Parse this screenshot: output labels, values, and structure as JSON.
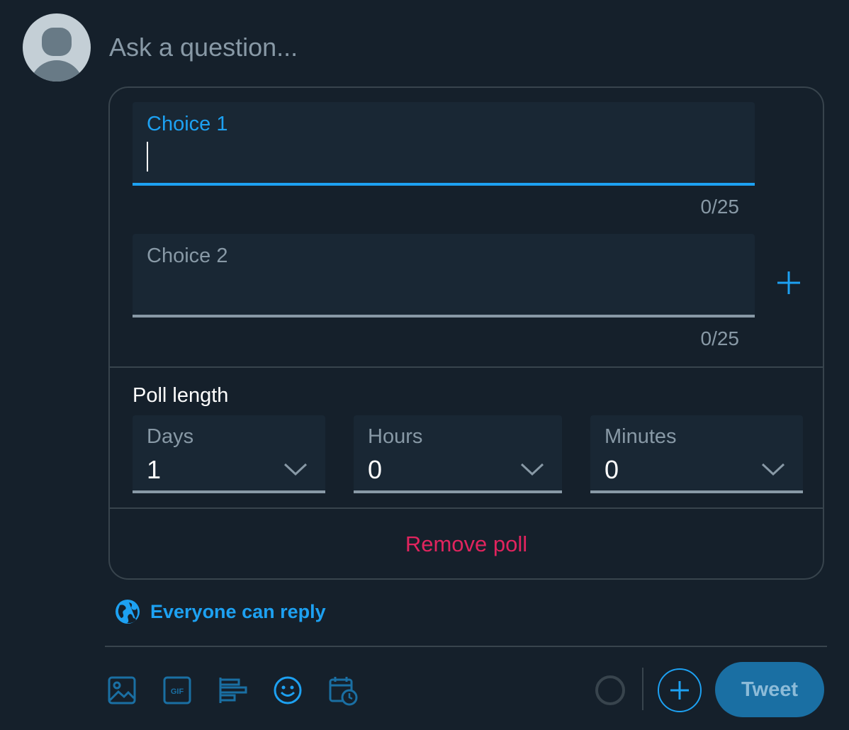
{
  "composer": {
    "placeholder": "Ask a question..."
  },
  "poll": {
    "choices": [
      {
        "label": "Choice 1",
        "value": "",
        "counter": "0/25",
        "state": "focused"
      },
      {
        "label": "Choice 2",
        "value": "",
        "counter": "0/25",
        "state": "idle"
      }
    ],
    "add_choice_icon": "plus-icon",
    "length_title": "Poll length",
    "length": {
      "days": {
        "label": "Days",
        "value": "1"
      },
      "hours": {
        "label": "Hours",
        "value": "0"
      },
      "minutes": {
        "label": "Minutes",
        "value": "0"
      }
    },
    "remove_label": "Remove poll"
  },
  "reply_setting": {
    "icon": "globe-icon",
    "label": "Everyone can reply"
  },
  "toolbar": {
    "icons": [
      "image-icon",
      "gif-icon",
      "poll-icon",
      "emoji-icon",
      "schedule-icon"
    ],
    "add_icon": "plus-circle-icon",
    "tweet_label": "Tweet"
  },
  "colors": {
    "background": "#15202b",
    "accent": "#1da1f2",
    "danger": "#e0245e",
    "muted": "#8899a6",
    "border": "#38444d",
    "field_bg": "#192734"
  }
}
